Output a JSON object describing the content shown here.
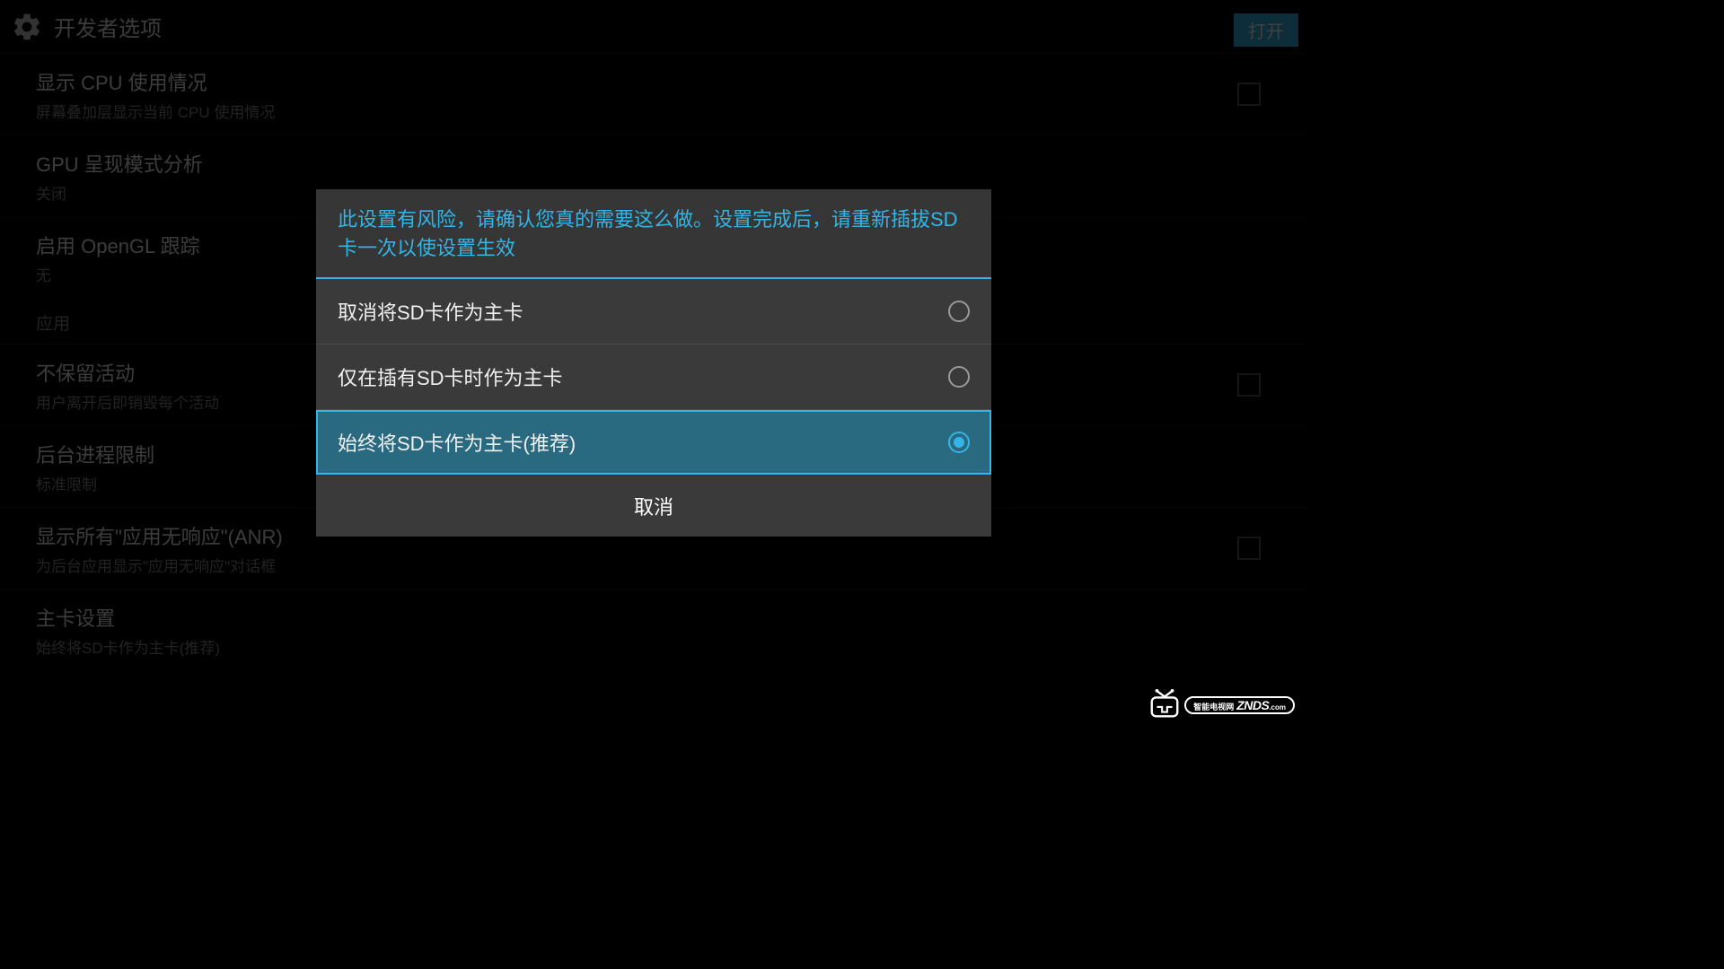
{
  "header": {
    "title": "开发者选项",
    "open_button": "打开"
  },
  "settings": [
    {
      "title": "显示 CPU 使用情况",
      "subtitle": "屏幕叠加层显示当前 CPU 使用情况",
      "has_checkbox": true
    },
    {
      "title": "GPU 呈现模式分析",
      "subtitle": "关闭",
      "has_checkbox": false
    },
    {
      "title": "启用 OpenGL 跟踪",
      "subtitle": "无",
      "has_checkbox": false
    }
  ],
  "section_header": "应用",
  "settings2": [
    {
      "title": "不保留活动",
      "subtitle": "用户离开后即销毁每个活动",
      "has_checkbox": true
    },
    {
      "title": "后台进程限制",
      "subtitle": "标准限制",
      "has_checkbox": false
    },
    {
      "title": "显示所有\"应用无响应\"(ANR)",
      "subtitle": "为后台应用显示\"应用无响应\"对话框",
      "has_checkbox": true
    },
    {
      "title": "主卡设置",
      "subtitle": "始终将SD卡作为主卡(推荐)",
      "has_checkbox": false
    }
  ],
  "dialog": {
    "warning": "此设置有风险，请确认您真的需要这么做。设置完成后，请重新插拔SD卡一次以使设置生效",
    "options": [
      {
        "label": "取消将SD卡作为主卡",
        "selected": false
      },
      {
        "label": "仅在插有SD卡时作为主卡",
        "selected": false
      },
      {
        "label": "始终将SD卡作为主卡(推荐)",
        "selected": true
      }
    ],
    "cancel": "取消"
  },
  "logo": {
    "chinese": "智能电视网",
    "text": "ZNDS",
    "com": ".com"
  }
}
